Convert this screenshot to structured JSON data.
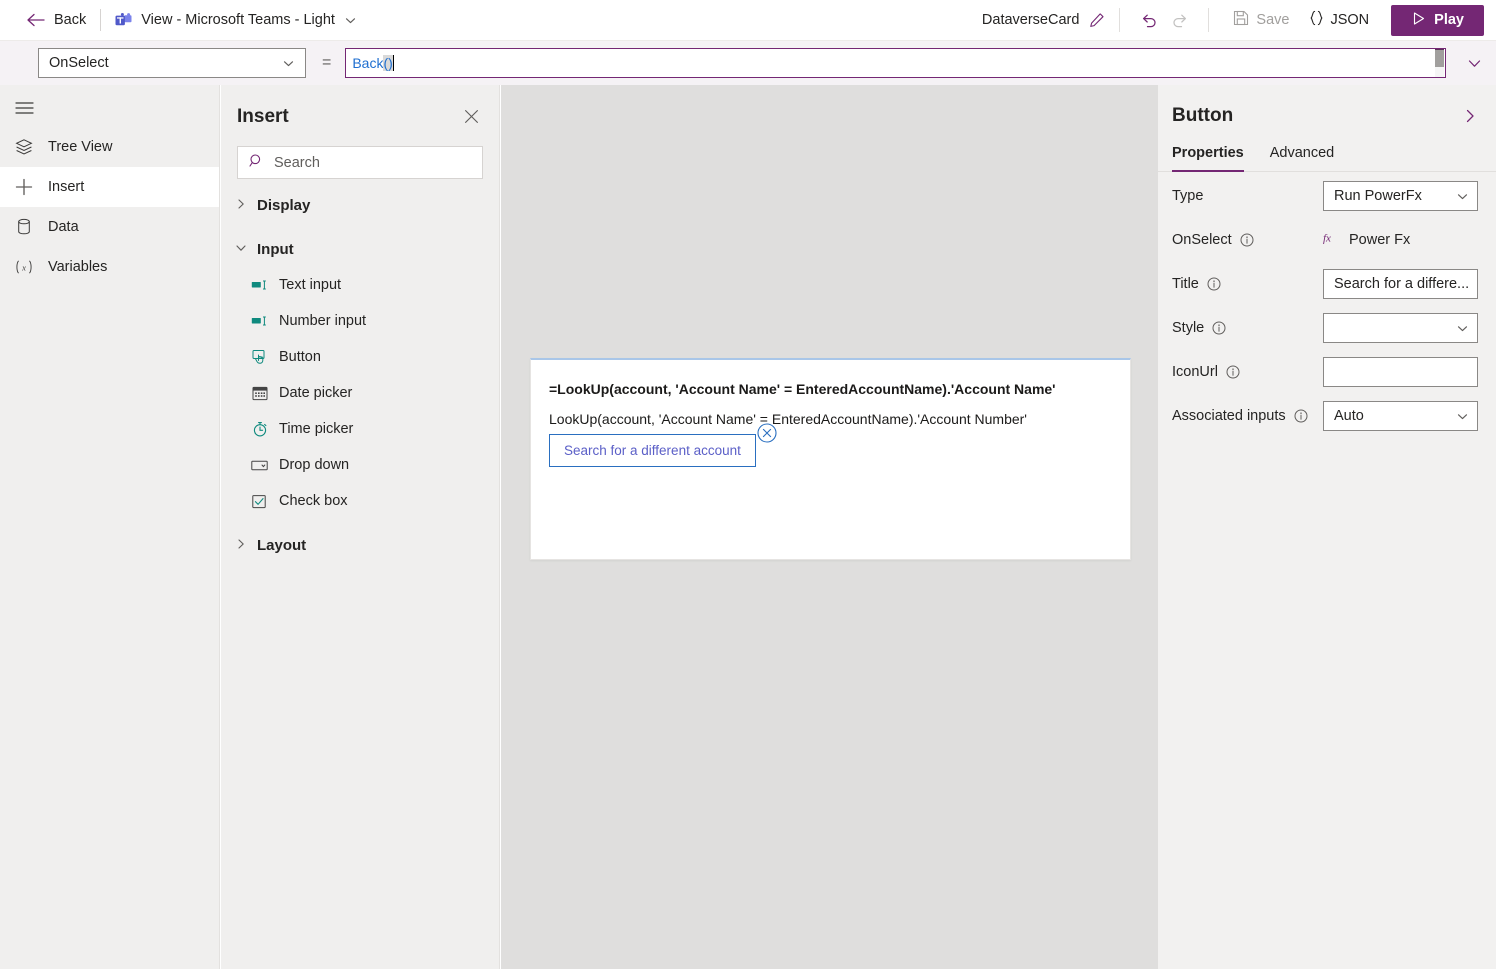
{
  "topbar": {
    "back_label": "Back",
    "title": "View - Microsoft Teams - Light",
    "doc_name": "DataverseCard",
    "save_label": "Save",
    "json_label": "JSON",
    "play_label": "Play",
    "accent_color": "#742774"
  },
  "formula_bar": {
    "property": "OnSelect",
    "equals": "=",
    "formula_identifier": "Back",
    "formula_parens": "()",
    "full_formula": "Back()"
  },
  "rail": {
    "items": [
      {
        "label": "Tree View",
        "icon": "layers-icon",
        "active": false
      },
      {
        "label": "Insert",
        "icon": "plus-icon",
        "active": true
      },
      {
        "label": "Data",
        "icon": "database-icon",
        "active": false
      },
      {
        "label": "Variables",
        "icon": "variable-icon",
        "active": false
      }
    ]
  },
  "insert_panel": {
    "title": "Insert",
    "search_placeholder": "Search",
    "groups": [
      {
        "label": "Display",
        "expanded": false,
        "items": []
      },
      {
        "label": "Input",
        "expanded": true,
        "items": [
          {
            "label": "Text input",
            "icon": "text-input-icon"
          },
          {
            "label": "Number input",
            "icon": "number-input-icon"
          },
          {
            "label": "Button",
            "icon": "button-icon"
          },
          {
            "label": "Date picker",
            "icon": "calendar-icon"
          },
          {
            "label": "Time picker",
            "icon": "clock-icon"
          },
          {
            "label": "Drop down",
            "icon": "dropdown-icon"
          },
          {
            "label": "Check box",
            "icon": "checkbox-icon"
          }
        ]
      },
      {
        "label": "Layout",
        "expanded": false,
        "items": []
      }
    ]
  },
  "canvas": {
    "card": {
      "line1": "=LookUp(account, 'Account Name' = EnteredAccountName).'Account Name'",
      "line2": "LookUp(account, 'Account Name' = EnteredAccountName).'Account Number'",
      "button_label": "Search for a different account"
    }
  },
  "properties_panel": {
    "title": "Button",
    "tabs": [
      {
        "label": "Properties",
        "active": true
      },
      {
        "label": "Advanced",
        "active": false
      }
    ],
    "fields": [
      {
        "label": "Type",
        "kind": "dropdown",
        "value": "Run PowerFx",
        "info": true
      },
      {
        "label": "OnSelect",
        "kind": "fx",
        "value": "Power Fx",
        "info": true
      },
      {
        "label": "Title",
        "kind": "text",
        "value": "Search for a differe...",
        "info": true
      },
      {
        "label": "Style",
        "kind": "dropdown",
        "value": "",
        "info": true
      },
      {
        "label": "IconUrl",
        "kind": "text",
        "value": "",
        "info": true
      },
      {
        "label": "Associated inputs",
        "kind": "dropdown",
        "value": "Auto",
        "info": true
      }
    ]
  }
}
